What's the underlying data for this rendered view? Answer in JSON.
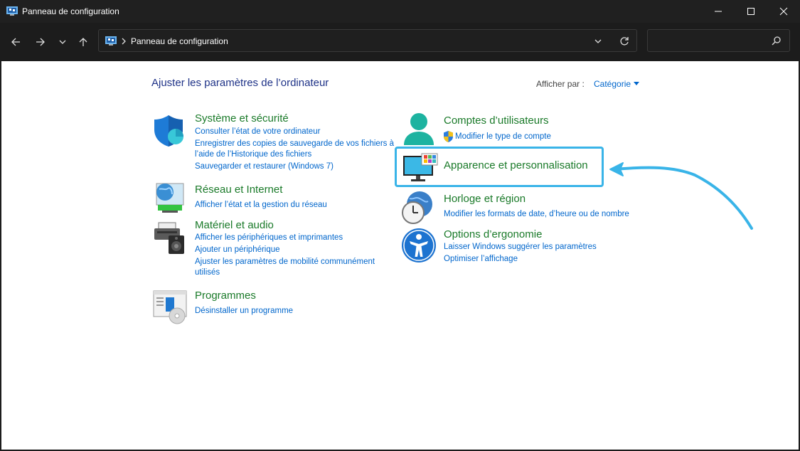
{
  "window": {
    "title": "Panneau de configuration"
  },
  "nav": {
    "breadcrumb": "Panneau de configuration",
    "search_placeholder": ""
  },
  "main": {
    "heading": "Ajuster les paramètres de l’ordinateur",
    "view_by_label": "Afficher par :",
    "view_by_value": "Catégorie"
  },
  "categories": {
    "system": {
      "title": "Système et sécurité",
      "links": [
        "Consulter l’état de votre ordinateur",
        "Enregistrer des copies de sauvegarde de vos fichiers à",
        "l’aide de l’Historique des fichiers",
        "Sauvegarder et restaurer (Windows 7)"
      ]
    },
    "network": {
      "title": "Réseau et Internet",
      "links": [
        "Afficher l’état et la gestion du réseau"
      ]
    },
    "hardware": {
      "title": "Matériel et audio",
      "links": [
        "Afficher les périphériques et imprimantes",
        "Ajouter un périphérique",
        "Ajuster les paramètres de mobilité communément",
        "utilisés"
      ]
    },
    "programs": {
      "title": "Programmes",
      "links": [
        "Désinstaller un programme"
      ]
    },
    "accounts": {
      "title": "Comptes d’utilisateurs",
      "links": [
        "Modifier le type de compte"
      ]
    },
    "appearance": {
      "title": "Apparence et personnalisation"
    },
    "clock": {
      "title": "Horloge et région",
      "links": [
        "Modifier les formats de date, d’heure ou de nombre"
      ]
    },
    "ease": {
      "title": "Options d’ergonomie",
      "links": [
        "Laisser Windows suggérer les paramètres",
        "Optimiser l’affichage"
      ]
    }
  },
  "colors": {
    "category_green": "#1a7a29",
    "link_blue": "#0066cc",
    "heading_blue": "#1e3287",
    "highlight": "#39b4e8"
  }
}
